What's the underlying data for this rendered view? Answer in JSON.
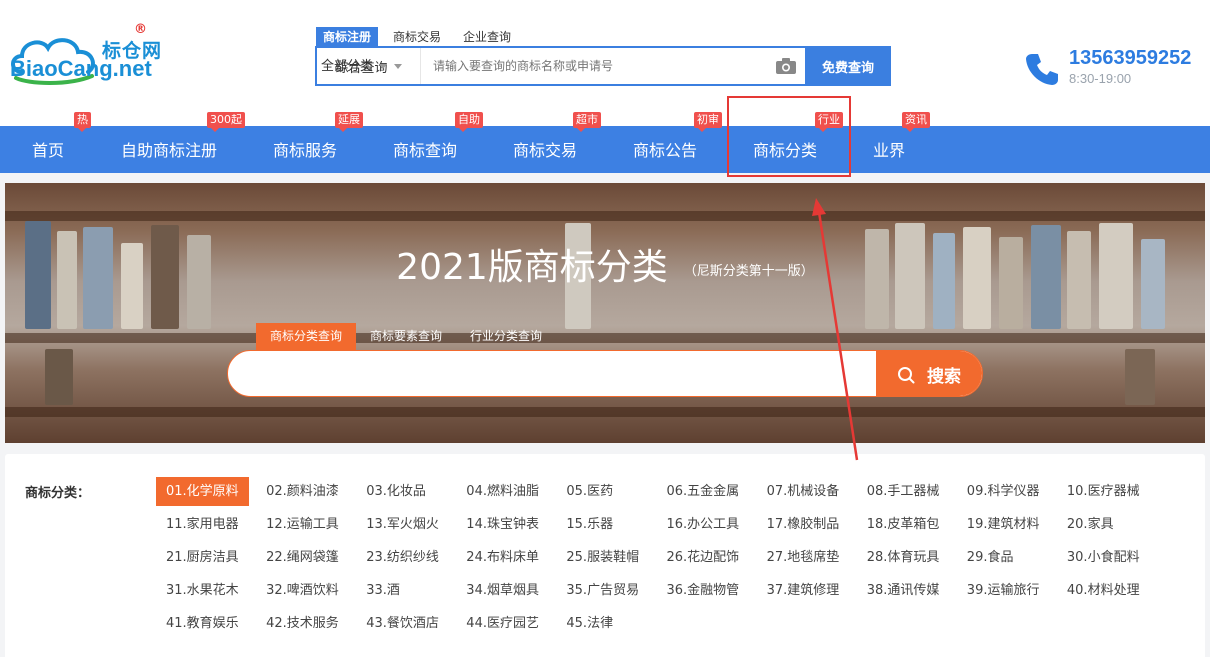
{
  "logo": {
    "cn": "标仓网",
    "reg": "®",
    "en": "BiaoCang.net"
  },
  "search_tabs": [
    "商标注册",
    "商标交易",
    "企业查询"
  ],
  "search": {
    "scope": "综合查询",
    "placeholder": "请输入要查询的商标名称或申请号",
    "category": "全部分类",
    "button": "免费查询"
  },
  "contact": {
    "phone": "13563959252",
    "hours": "8:30-19:00"
  },
  "nav": [
    {
      "label": "首页",
      "badge": "热"
    },
    {
      "label": "自助商标注册",
      "badge": "300起"
    },
    {
      "label": "商标服务",
      "badge": "延展"
    },
    {
      "label": "商标查询",
      "badge": "自助"
    },
    {
      "label": "商标交易",
      "badge": "超市"
    },
    {
      "label": "商标公告",
      "badge": "初审"
    },
    {
      "label": "商标分类",
      "badge": "行业"
    },
    {
      "label": "业界",
      "badge": "资讯"
    }
  ],
  "banner": {
    "title": "2021版商标分类",
    "subtitle": "（尼斯分类第十一版）",
    "tabs": [
      "商标分类查询",
      "商标要素查询",
      "行业分类查询"
    ],
    "search_value": "",
    "search_button": "搜索"
  },
  "categories": {
    "label": "商标分类：",
    "items": [
      "01.化学原料",
      "02.颜料油漆",
      "03.化妆品",
      "04.燃料油脂",
      "05.医药",
      "06.五金金属",
      "07.机械设备",
      "08.手工器械",
      "09.科学仪器",
      "10.医疗器械",
      "11.家用电器",
      "12.运输工具",
      "13.军火烟火",
      "14.珠宝钟表",
      "15.乐器",
      "16.办公工具",
      "17.橡胶制品",
      "18.皮革箱包",
      "19.建筑材料",
      "20.家具",
      "21.厨房洁具",
      "22.绳网袋篷",
      "23.纺织纱线",
      "24.布料床单",
      "25.服装鞋帽",
      "26.花边配饰",
      "27.地毯席垫",
      "28.体育玩具",
      "29.食品",
      "30.小食配料",
      "31.水果花木",
      "32.啤酒饮料",
      "33.酒",
      "34.烟草烟具",
      "35.广告贸易",
      "36.金融物管",
      "37.建筑修理",
      "38.通讯传媒",
      "39.运输旅行",
      "40.材料处理",
      "41.教育娱乐",
      "42.技术服务",
      "43.餐饮酒店",
      "44.医疗园艺",
      "45.法律"
    ]
  },
  "colors": {
    "nav_blue": "#3d80e3",
    "accent_orange": "#f26a2e",
    "annotation_red": "#e53935"
  }
}
